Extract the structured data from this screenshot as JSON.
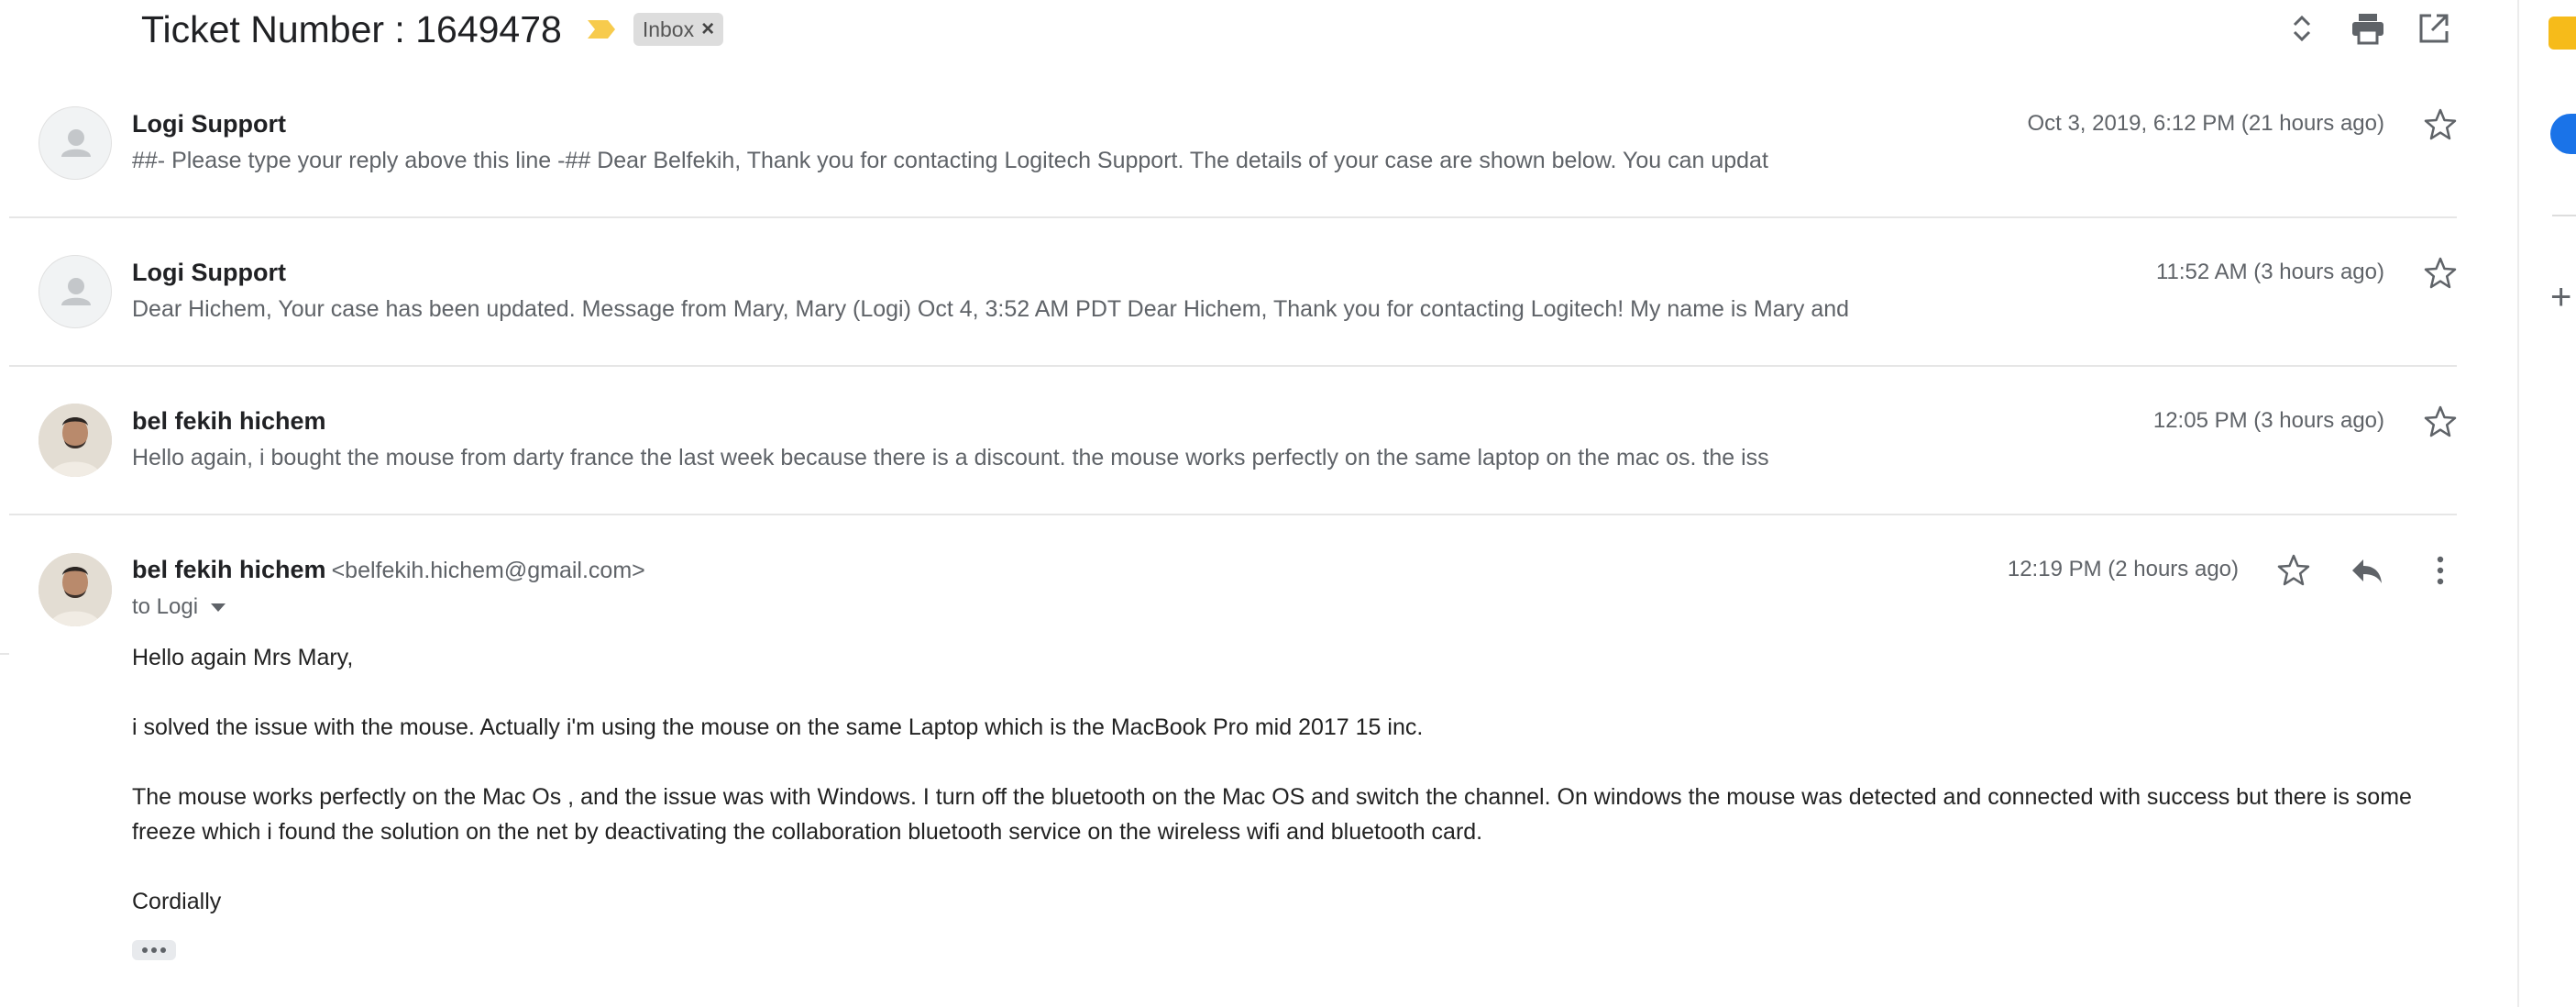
{
  "header": {
    "subject": "Ticket Number : 1649478",
    "label": "Inbox",
    "label_remove": "×",
    "tools": [
      "expand-collapse-icon",
      "print-icon",
      "open-new-window-icon"
    ]
  },
  "messages": [
    {
      "sender": "Logi Support",
      "timestamp": "Oct 3, 2019, 6:12 PM (21 hours ago)",
      "snippet": "##- Please type your reply above this line -## Dear Belfekih, Thank you for contacting Logitech Support. The details of your case are shown below. You can updat",
      "avatar": "default-person-icon",
      "starred": false
    },
    {
      "sender": "Logi Support",
      "timestamp": "11:52 AM (3 hours ago)",
      "snippet": "Dear Hichem, Your case has been updated. Message from Mary, Mary (Logi) Oct 4, 3:52 AM PDT Dear Hichem, Thank you for contacting Logitech! My name is Mary and",
      "avatar": "default-person-icon",
      "starred": false
    },
    {
      "sender": "bel fekih hichem",
      "timestamp": "12:05 PM (3 hours ago)",
      "snippet": "Hello again, i bought the mouse from darty france the last week because there is a discount. the mouse works perfectly on the same laptop on the mac os. the iss",
      "avatar": "user-photo",
      "starred": false
    }
  ],
  "open_message": {
    "sender": "bel fekih hichem",
    "email": "<belfekih.hichem@gmail.com>",
    "timestamp": "12:19 PM (2 hours ago)",
    "recipients": "to Logi",
    "body": [
      "Hello again Mrs Mary,",
      "i solved the issue with the mouse. Actually i'm using the mouse on the same Laptop which is the MacBook Pro mid 2017 15 inc.",
      "The mouse works perfectly on the Mac Os , and the issue was with Windows. I turn off the bluetooth on the Mac OS and switch the channel. On windows the mouse was detected and connected with success but there is some freeze which i found the solution on the net by deactivating the collaboration bluetooth service on the wireless wifi and bluetooth card.",
      "Cordially"
    ]
  },
  "side_panel": {
    "add_label": "+"
  },
  "colors": {
    "accent_blue": "#1a73e8",
    "keep_yellow": "#f6bb1a",
    "importance_marker": "#f7cb4d",
    "text_secondary": "#5f6368"
  }
}
